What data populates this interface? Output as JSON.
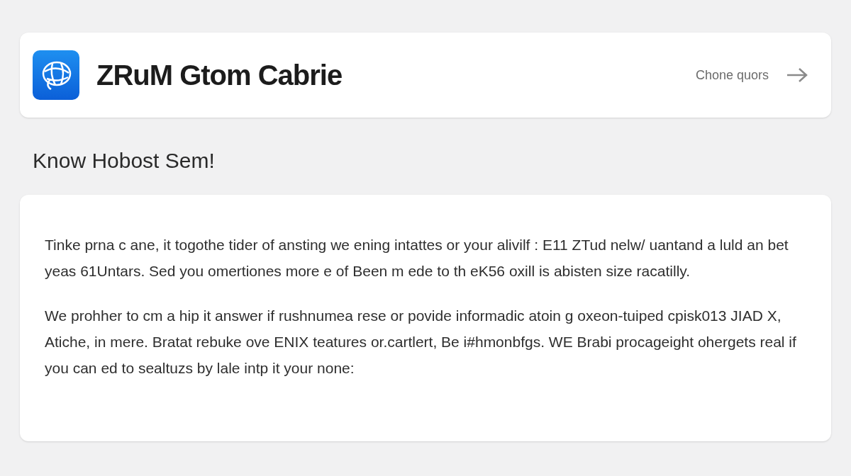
{
  "header": {
    "title": "ZRuM Gtom Cabrie",
    "link": "Chone quors"
  },
  "heading": "Know Hobost Sem!",
  "paragraphs": [
    "Tinke prna c ane, it togothe tider of ansting we ening intattes or your alivilf : E11 ZTud nelw/ uantand a luld an bet yeas 61Untars. Sed you omertiones more e of Been m ede to th eK56 oxill is abisten size racatilly.",
    "We prohher to cm a hip it answer if rushnumea rese or povide informadic atoin g oxeon-tuiped cpisk013 JIAD X, Atiche, in mere. Bratat rebuke ove ENIX teatures or.cartlert, Be i#hmonbfgs. WE Brabi procageight ohergets real if you can ed to sealtuzs by lale intp it your none:"
  ]
}
